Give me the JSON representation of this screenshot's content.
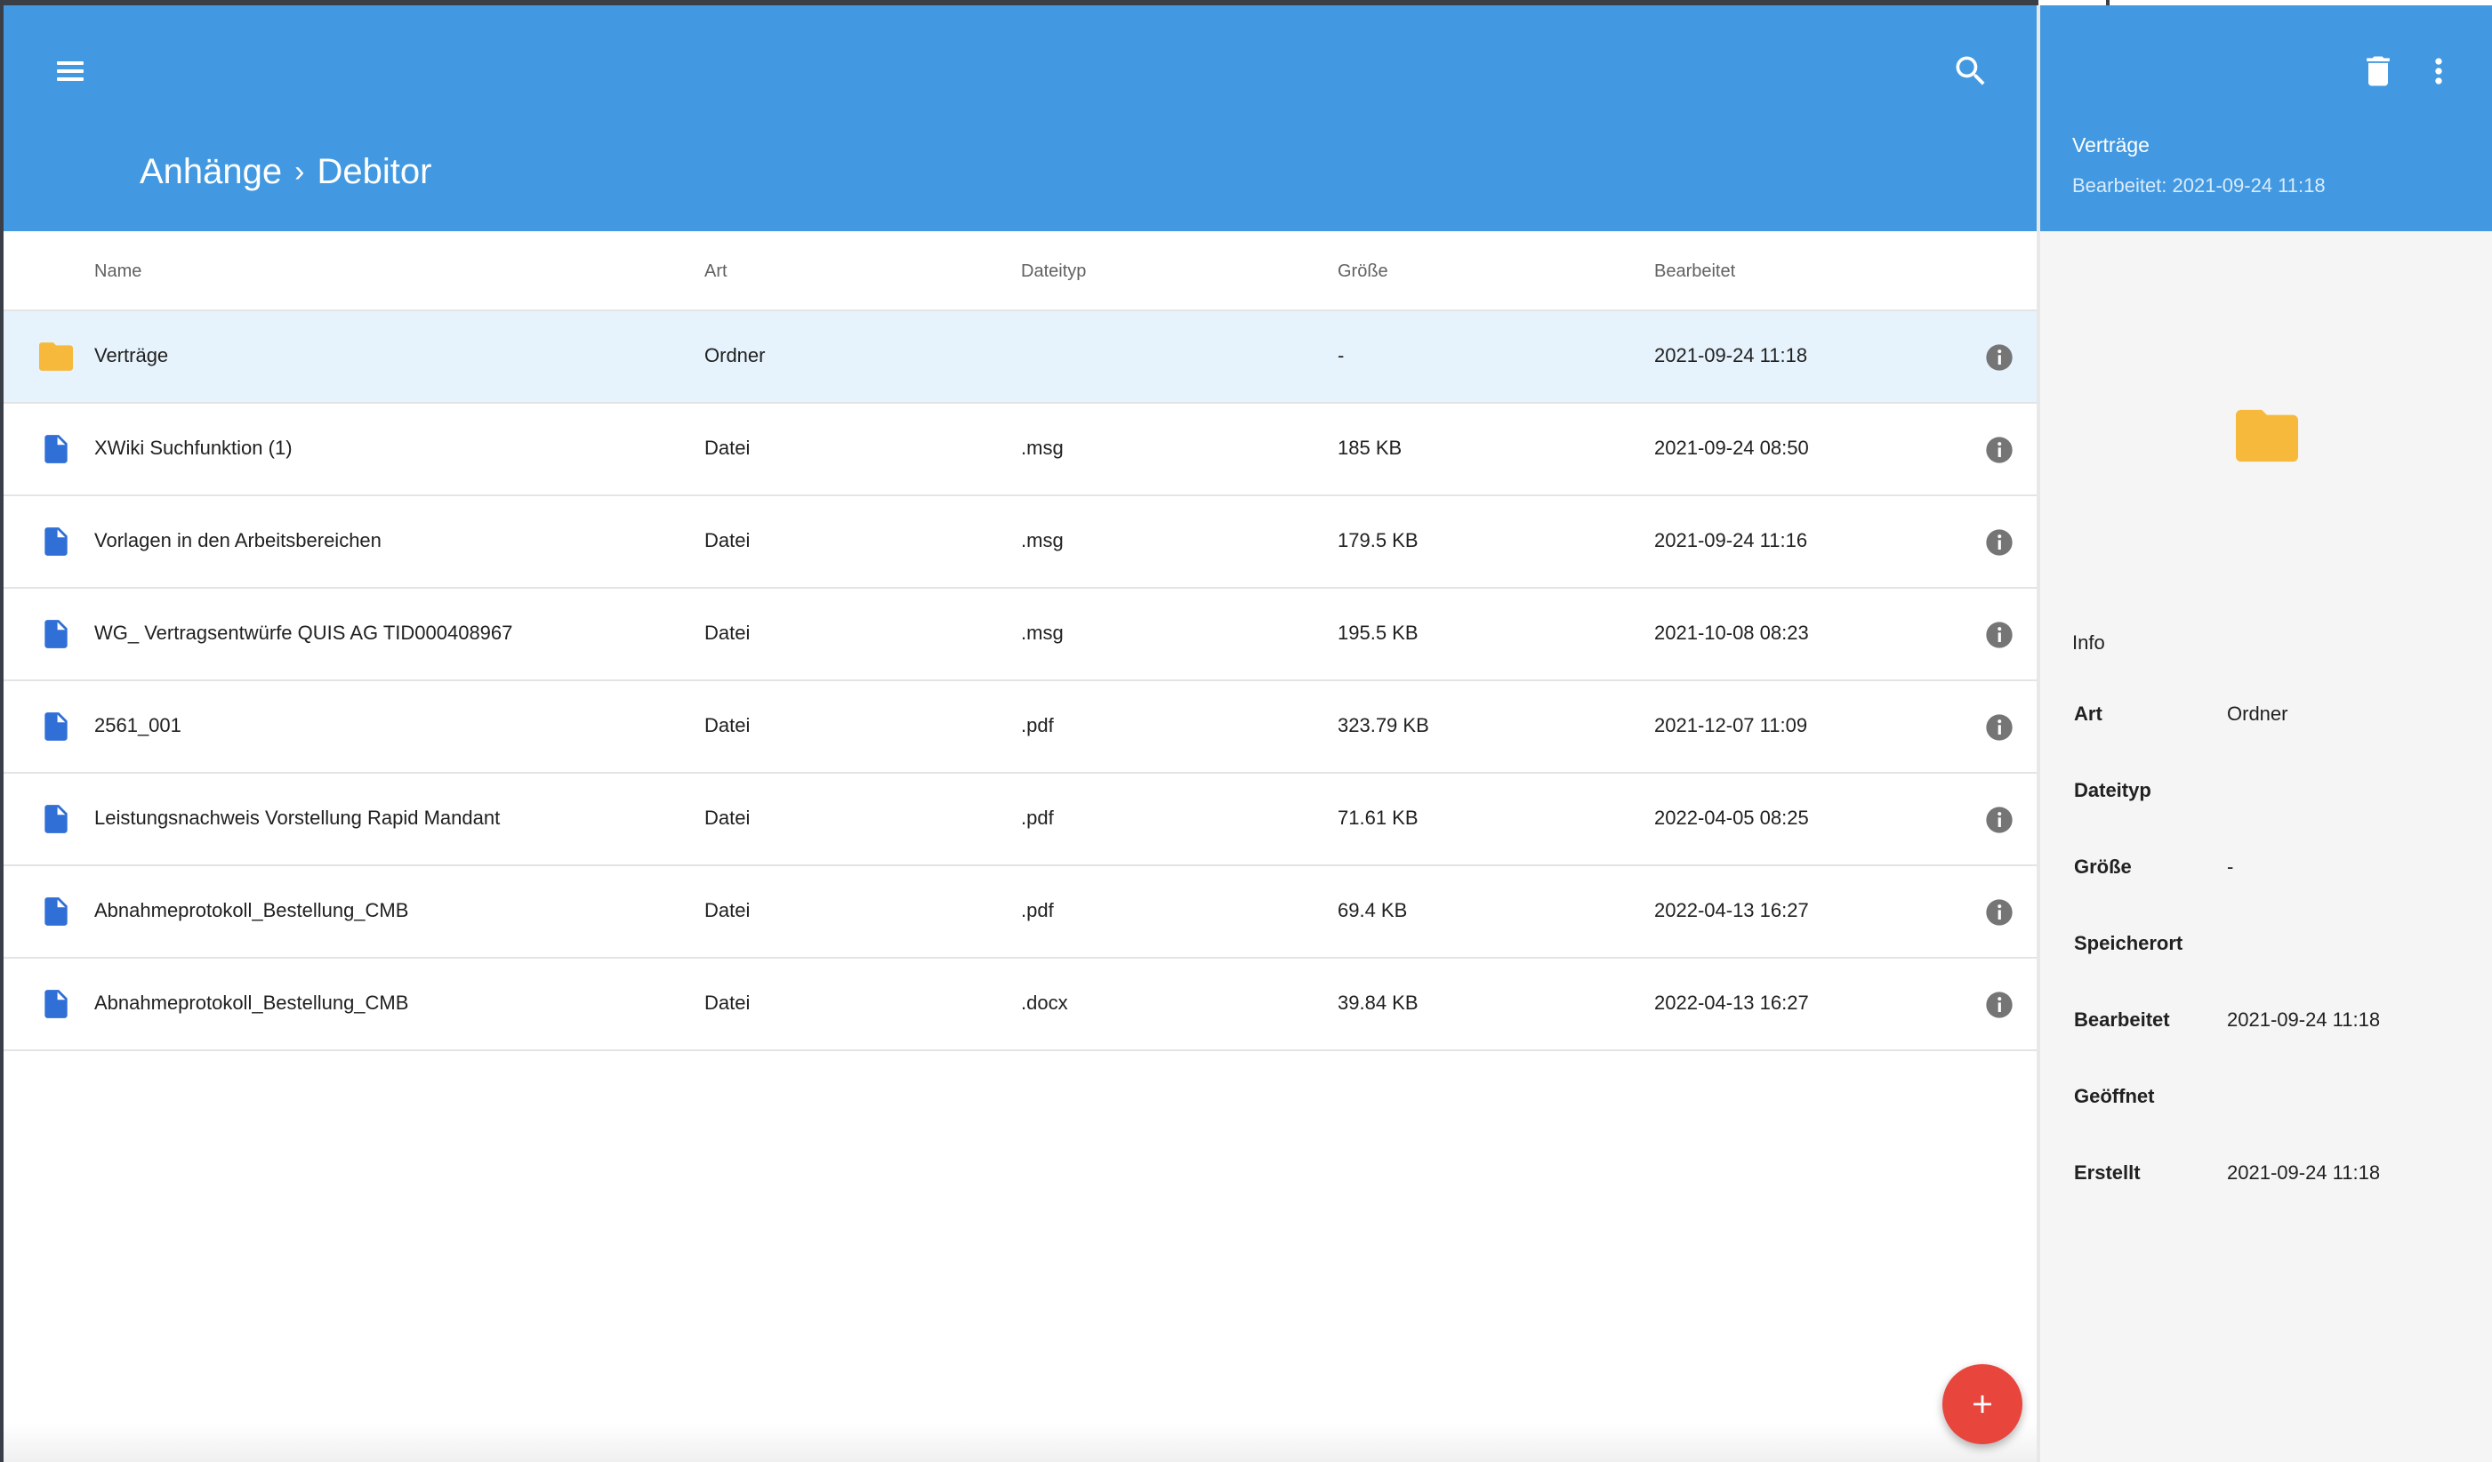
{
  "header": {
    "breadcrumb": [
      "Anhänge",
      "Debitor"
    ],
    "separator": "›",
    "menu_icon": "menu-icon",
    "search_icon": "search-icon"
  },
  "table": {
    "columns": [
      "Name",
      "Art",
      "Dateityp",
      "Größe",
      "Bearbeitet"
    ],
    "rows": [
      {
        "icon": "folder-icon",
        "name": "Verträge",
        "art": "Ordner",
        "type": "",
        "size": "-",
        "edited": "2021-09-24 11:18",
        "selected": true
      },
      {
        "icon": "file-icon",
        "name": "XWiki Suchfunktion (1)",
        "art": "Datei",
        "type": ".msg",
        "size": "185 KB",
        "edited": "2021-09-24 08:50"
      },
      {
        "icon": "file-icon",
        "name": "Vorlagen in den Arbeitsbereichen",
        "art": "Datei",
        "type": ".msg",
        "size": "179.5 KB",
        "edited": "2021-09-24 11:16"
      },
      {
        "icon": "file-icon",
        "name": "WG_ Vertragsentwürfe QUIS AG TID000408967",
        "art": "Datei",
        "type": ".msg",
        "size": "195.5 KB",
        "edited": "2021-10-08 08:23"
      },
      {
        "icon": "file-icon",
        "name": "2561_001",
        "art": "Datei",
        "type": ".pdf",
        "size": "323.79 KB",
        "edited": "2021-12-07 11:09"
      },
      {
        "icon": "file-icon",
        "name": "Leistungsnachweis Vorstellung Rapid Mandant",
        "art": "Datei",
        "type": ".pdf",
        "size": "71.61 KB",
        "edited": "2022-04-05 08:25"
      },
      {
        "icon": "file-icon",
        "name": "Abnahmeprotokoll_Bestellung_CMB",
        "art": "Datei",
        "type": ".pdf",
        "size": "69.4 KB",
        "edited": "2022-04-13 16:27"
      },
      {
        "icon": "file-icon",
        "name": "Abnahmeprotokoll_Bestellung_CMB",
        "art": "Datei",
        "type": ".docx",
        "size": "39.84 KB",
        "edited": "2022-04-13 16:27"
      }
    ]
  },
  "side": {
    "title": "Verträge",
    "edited": "Bearbeitet: 2021-09-24 11:18",
    "info_label": "Info",
    "properties": [
      {
        "key": "Art",
        "value": "Ordner"
      },
      {
        "key": "Dateityp",
        "value": ""
      },
      {
        "key": "Größe",
        "value": "-"
      },
      {
        "key": "Speicherort",
        "value": ""
      },
      {
        "key": "Bearbeitet",
        "value": "2021-09-24 11:18"
      },
      {
        "key": "Geöffnet",
        "value": ""
      },
      {
        "key": "Erstellt",
        "value": "2021-09-24 11:18"
      }
    ]
  },
  "colors": {
    "header_blue": "#4299e1",
    "folder_yellow": "#f6b93b",
    "file_blue": "#2f6fd6",
    "fab_red": "#e8453c",
    "selected_row": "#e6f3fc"
  }
}
